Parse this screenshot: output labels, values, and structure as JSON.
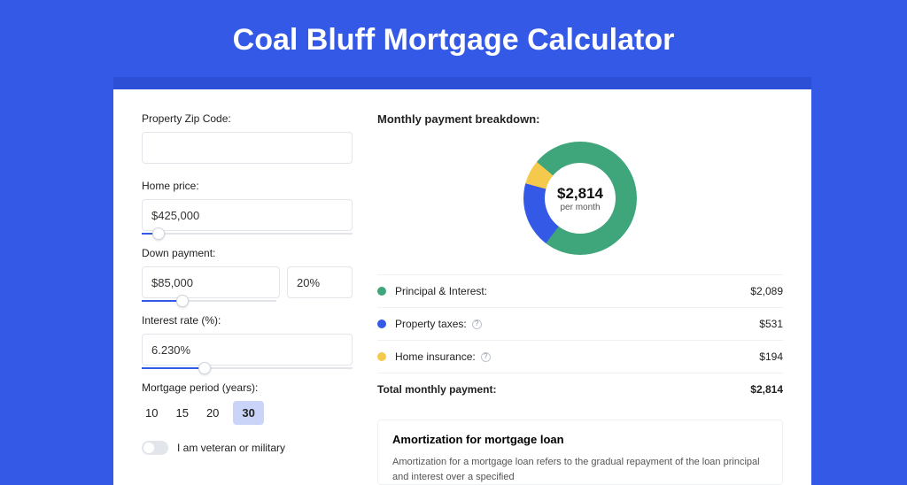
{
  "title": "Coal Bluff Mortgage Calculator",
  "form": {
    "zip_label": "Property Zip Code:",
    "zip_value": "",
    "home_price_label": "Home price:",
    "home_price_value": "$425,000",
    "down_payment_label": "Down payment:",
    "down_payment_value": "$85,000",
    "down_payment_pct": "20%",
    "interest_label": "Interest rate (%):",
    "interest_value": "6.230%",
    "period_label": "Mortgage period (years):",
    "period_options": [
      "10",
      "15",
      "20",
      "30"
    ],
    "period_selected": "30",
    "veteran_label": "I am veteran or military",
    "sliders": {
      "home_price_pct": 8,
      "down_payment_pct": 20,
      "interest_pct": 30
    }
  },
  "breakdown": {
    "title": "Monthly payment breakdown:",
    "center_value": "$2,814",
    "center_sub": "per month",
    "items": [
      {
        "label": "Principal & Interest:",
        "amount": "$2,089",
        "color": "#3fa57a",
        "info": false
      },
      {
        "label": "Property taxes:",
        "amount": "$531",
        "color": "#3459e6",
        "info": true
      },
      {
        "label": "Home insurance:",
        "amount": "$194",
        "color": "#f4c94c",
        "info": true
      }
    ],
    "total_label": "Total monthly payment:",
    "total_amount": "$2,814"
  },
  "amortization": {
    "title": "Amortization for mortgage loan",
    "text": "Amortization for a mortgage loan refers to the gradual repayment of the loan principal and interest over a specified"
  },
  "chart_data": {
    "type": "pie",
    "title": "Monthly payment breakdown",
    "series": [
      {
        "name": "Principal & Interest",
        "value": 2089,
        "color": "#3fa57a"
      },
      {
        "name": "Property taxes",
        "value": 531,
        "color": "#3459e6"
      },
      {
        "name": "Home insurance",
        "value": 194,
        "color": "#f4c94c"
      }
    ],
    "total": 2814,
    "center_label": "$2,814 per month"
  }
}
